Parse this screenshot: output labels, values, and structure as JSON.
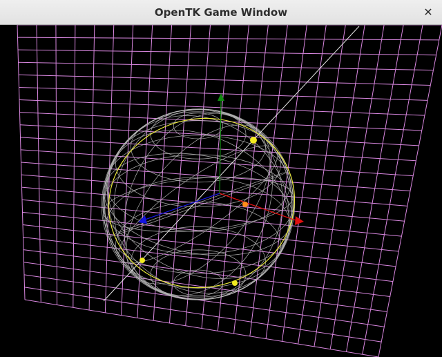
{
  "window": {
    "title": "OpenTK Game Window",
    "close_glyph": "✕",
    "close_icon": "close-icon"
  },
  "scene": {
    "background_color": "#000000",
    "grid_color": "#d987e0",
    "sphere_color": "#b5b5b5",
    "orbit_color": "#e8e83a",
    "ray_color": "#e6e6e6",
    "axes": {
      "x_color": "#e01010",
      "y_color": "#108a10",
      "z_color": "#1414e0"
    },
    "marker_colors": {
      "yellow": "#f2ea20",
      "orange": "#ff8c1a"
    }
  }
}
